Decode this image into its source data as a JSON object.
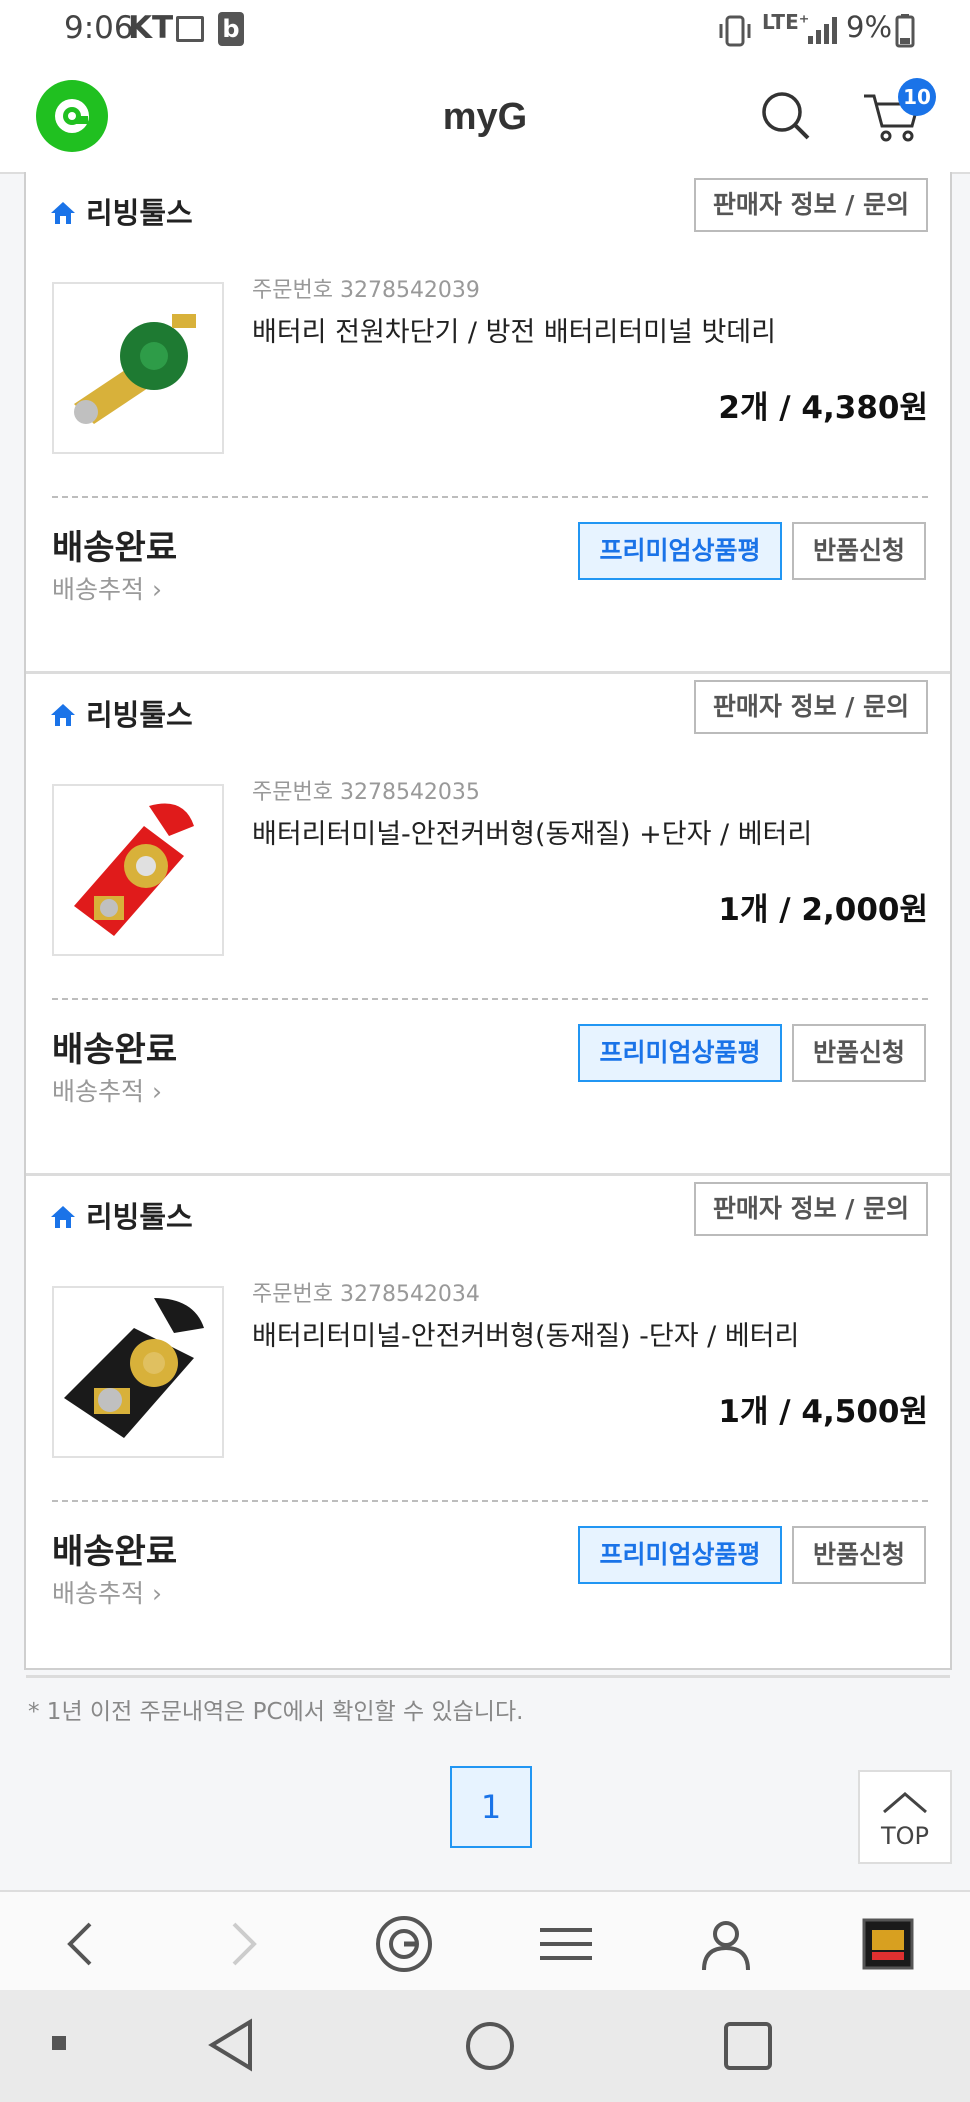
{
  "status_bar": {
    "time": "9:06",
    "carrier": "KT",
    "network": "LTE⁺",
    "battery": "9%"
  },
  "header": {
    "title": "myG",
    "cart_count": "10"
  },
  "orders": [
    {
      "seller": "리빙툴스",
      "seller_button": "판매자 정보 / 문의",
      "order_number": "주문번호 3278542039",
      "product_name": "배터리 전원차단기 / 방전 배터리터미널 밧데리",
      "qty_price": "2개 / 4,380원",
      "status": "배송완료",
      "track": "배송추적 ›",
      "premium_button": "프리미엄상품평",
      "return_button": "반품신청",
      "thumb_color": "#1e7a32"
    },
    {
      "seller": "리빙툴스",
      "seller_button": "판매자 정보 / 문의",
      "order_number": "주문번호 3278542035",
      "product_name": "배터리터미널-안전커버형(동재질) +단자 / 베터리",
      "qty_price": "1개 / 2,000원",
      "status": "배송완료",
      "track": "배송추적 ›",
      "premium_button": "프리미엄상품평",
      "return_button": "반품신청",
      "thumb_color": "#e01b1b"
    },
    {
      "seller": "리빙툴스",
      "seller_button": "판매자 정보 / 문의",
      "order_number": "주문번호 3278542034",
      "product_name": "배터리터미널-안전커버형(동재질) -단자 / 베터리",
      "qty_price": "1개 / 4,500원",
      "status": "배송완료",
      "track": "배송추적 ›",
      "premium_button": "프리미엄상품평",
      "return_button": "반품신청",
      "thumb_color": "#1a1a1a"
    }
  ],
  "footer": {
    "note": "* 1년 이전 주문내역은 PC에서 확인할 수 있습니다.",
    "page": "1",
    "top_label": "TOP"
  },
  "colors": {
    "accent": "#2196f3",
    "brand": "#20c020"
  }
}
